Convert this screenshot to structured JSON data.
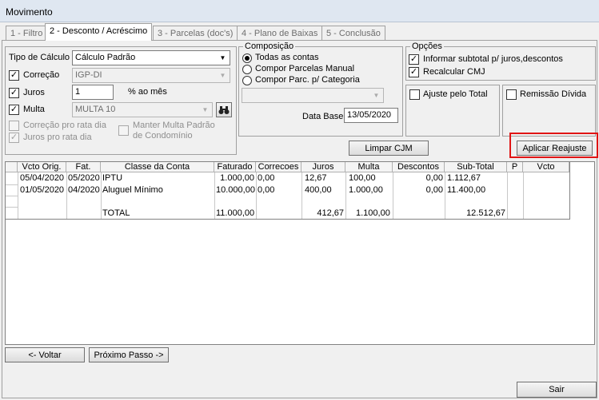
{
  "window": {
    "title": "Movimento"
  },
  "tabs": [
    "1 - Filtro",
    "2 - Desconto / Acréscimo",
    "3 - Parcelas (doc's)",
    "4 - Plano de Baixas",
    "5 - Conclusão"
  ],
  "left": {
    "tipo_label": "Tipo de Cálculo",
    "tipo_value": "Cálculo Padrão",
    "correcao_label": "Correção",
    "correcao_value": "IGP-DI",
    "juros_label": "Juros",
    "juros_value": "1",
    "juros_unit": "% ao mês",
    "multa_label": "Multa",
    "multa_value": "MULTA 10",
    "correcao_rata": "Correção pro rata dia",
    "juros_rata": "Juros pro rata dia",
    "manter_multa": "Manter Multa Padrão de Condomínio"
  },
  "composicao": {
    "title": "Composição",
    "options": [
      "Todas as contas",
      "Compor Parcelas Manual",
      "Compor Parc. p/ Categoria"
    ],
    "data_base_label": "Data Base",
    "data_base_value": "13/05/2020"
  },
  "opcoes": {
    "title": "Opções",
    "informar": "Informar subtotal p/ juros,descontos",
    "recalcular": "Recalcular CMJ"
  },
  "ajuste": "Ajuste pelo Total",
  "remissao": "Remissão Dívida",
  "buttons": {
    "limpar": "Limpar CJM",
    "aplicar": "Aplicar Reajuste",
    "voltar": "<- Voltar",
    "proximo": "Próximo Passo ->",
    "sair": "Sair"
  },
  "table": {
    "headers": [
      "Vcto Orig.",
      "Fat.",
      "Classe da Conta",
      "Faturado",
      "Correcoes",
      "Juros",
      "Multa",
      "Descontos",
      "Sub-Total",
      "P",
      "Vcto"
    ],
    "rows": [
      [
        "05/04/2020",
        "05/2020",
        "IPTU",
        "1.000,00",
        "0,00",
        "12,67",
        "100,00",
        "0,00",
        "1.112,67",
        "",
        ""
      ],
      [
        "01/05/2020",
        "04/2020",
        "Aluguel Mínimo",
        "10.000,00",
        "0,00",
        "400,00",
        "1.000,00",
        "0,00",
        "11.400,00",
        "",
        ""
      ]
    ],
    "total": {
      "label": "TOTAL",
      "faturado": "11.000,00",
      "juros": "412,67",
      "multa": "1.100,00",
      "subtotal": "12.512,67"
    }
  }
}
